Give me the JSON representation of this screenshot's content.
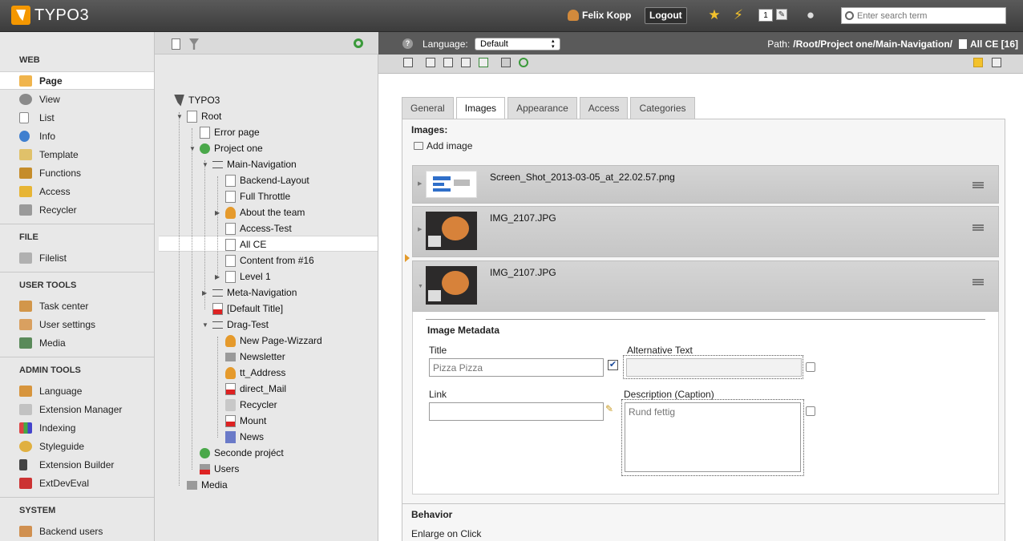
{
  "topbar": {
    "logo_text": "TYPO3",
    "user_name": "Felix Kopp",
    "logout_label": "Logout",
    "badge_count": "1",
    "search_placeholder": "Enter search term"
  },
  "modules": {
    "sections": [
      {
        "title": "WEB",
        "items": [
          "Page",
          "View",
          "List",
          "Info",
          "Template",
          "Functions",
          "Access",
          "Recycler"
        ]
      },
      {
        "title": "FILE",
        "items": [
          "Filelist"
        ]
      },
      {
        "title": "USER TOOLS",
        "items": [
          "Task center",
          "User settings",
          "Media"
        ]
      },
      {
        "title": "ADMIN TOOLS",
        "items": [
          "Language",
          "Extension Manager",
          "Indexing",
          "Styleguide",
          "Extension Builder",
          "ExtDevEval"
        ]
      },
      {
        "title": "SYSTEM",
        "items": [
          "Backend users"
        ]
      }
    ],
    "active": "Page"
  },
  "tree": {
    "nodes": [
      "TYPO3",
      "Root",
      "Error page",
      "Project one",
      "Main-Navigation",
      "Backend-Layout",
      "Full Throttle",
      "About the team",
      "Access-Test",
      "All CE",
      "Content from #16",
      "Level 1",
      "Meta-Navigation",
      "[Default Title]",
      "Drag-Test",
      "New Page-Wizzard",
      "Newsletter",
      "tt_Address",
      "direct_Mail",
      "Recycler",
      "Mount",
      "News",
      "Seconde projéct",
      "Users",
      "Media"
    ],
    "selected": "All CE"
  },
  "docheader": {
    "language_label": "Language:",
    "language_value": "Default",
    "path_label": "Path:",
    "path_value": "/Root/Project one/Main-Navigation/",
    "path_page": "All CE [16]"
  },
  "tabs": [
    "General",
    "Images",
    "Appearance",
    "Access",
    "Categories"
  ],
  "active_tab": "Images",
  "images": {
    "label": "Images:",
    "add_label": "Add image",
    "files": [
      "Screen_Shot_2013-03-05_at_22.02.57.png",
      "IMG_2107.JPG",
      "IMG_2107.JPG"
    ]
  },
  "metadata": {
    "title": "Image Metadata",
    "title_label": "Title",
    "title_placeholder": "Pizza Pizza",
    "alt_label": "Alternative Text",
    "link_label": "Link",
    "desc_label": "Description (Caption)",
    "desc_placeholder": "Rund fettig"
  },
  "behavior": {
    "title": "Behavior",
    "enlarge_label": "Enlarge on Click"
  },
  "colors": {
    "accent": "#f49700",
    "topbar": "#4a4a4a",
    "sidebar": "#e8e8e8"
  }
}
